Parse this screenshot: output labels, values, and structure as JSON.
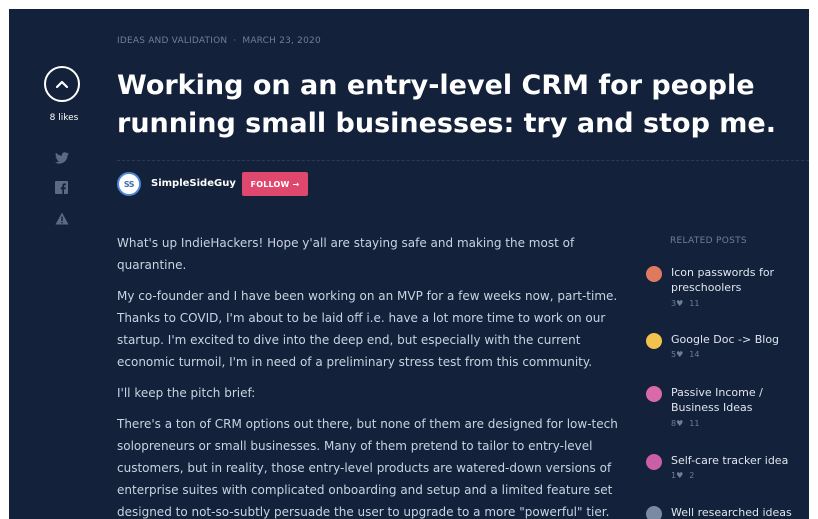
{
  "post": {
    "category": "IDEAS AND VALIDATION",
    "separator": "·",
    "date": "MARCH 23, 2020",
    "title": "Working on an entry-level CRM for people running small businesses: try and stop me.",
    "likes": "8 likes"
  },
  "author": {
    "initials": "SS",
    "name": "SimpleSideGuy",
    "follow_label": "FOLLOW →"
  },
  "share": {
    "icons": [
      "twitter-icon",
      "facebook-icon",
      "report-icon"
    ]
  },
  "body": {
    "paragraphs": [
      "What's up IndieHackers! Hope y'all are staying safe and making the most of quarantine.",
      "My co-founder and I have been working on an MVP for a few weeks now, part-time. Thanks to COVID, I'm about to be laid off i.e. have a lot more time to work on our startup. I'm excited to dive into the deep end, but especially with the current economic turmoil, I'm in need of a preliminary stress test from this community.",
      "I'll keep the pitch brief:",
      "There's a ton of CRM options out there, but none of them are designed for low-tech solopreneurs or small businesses. Many of them pretend to tailor to entry-level customers, but in reality, those entry-level products are watered-down versions of enterprise suites with complicated onboarding and setup and a limited feature set designed to not-so-subtly persuade the user to upgrade to a more \"powerful\" tier."
    ]
  },
  "related": {
    "heading": "RELATED POSTS",
    "items": [
      {
        "title": "Icon passwords for preschoolers",
        "likes": "3♥",
        "comments": "11",
        "avatar_color": "#e07a5f"
      },
      {
        "title": "Google Doc -> Blog",
        "likes": "5♥",
        "comments": "14",
        "avatar_color": "#f2c14e"
      },
      {
        "title": "Passive Income / Business Ideas",
        "likes": "8♥",
        "comments": "11",
        "avatar_color": "#d86aa8"
      },
      {
        "title": "Self-care tracker idea",
        "likes": "1♥",
        "comments": "2",
        "avatar_color": "#c95fa6"
      },
      {
        "title": "Well researched ideas for",
        "likes": "",
        "comments": "",
        "avatar_color": "#7b8aa3"
      }
    ]
  }
}
